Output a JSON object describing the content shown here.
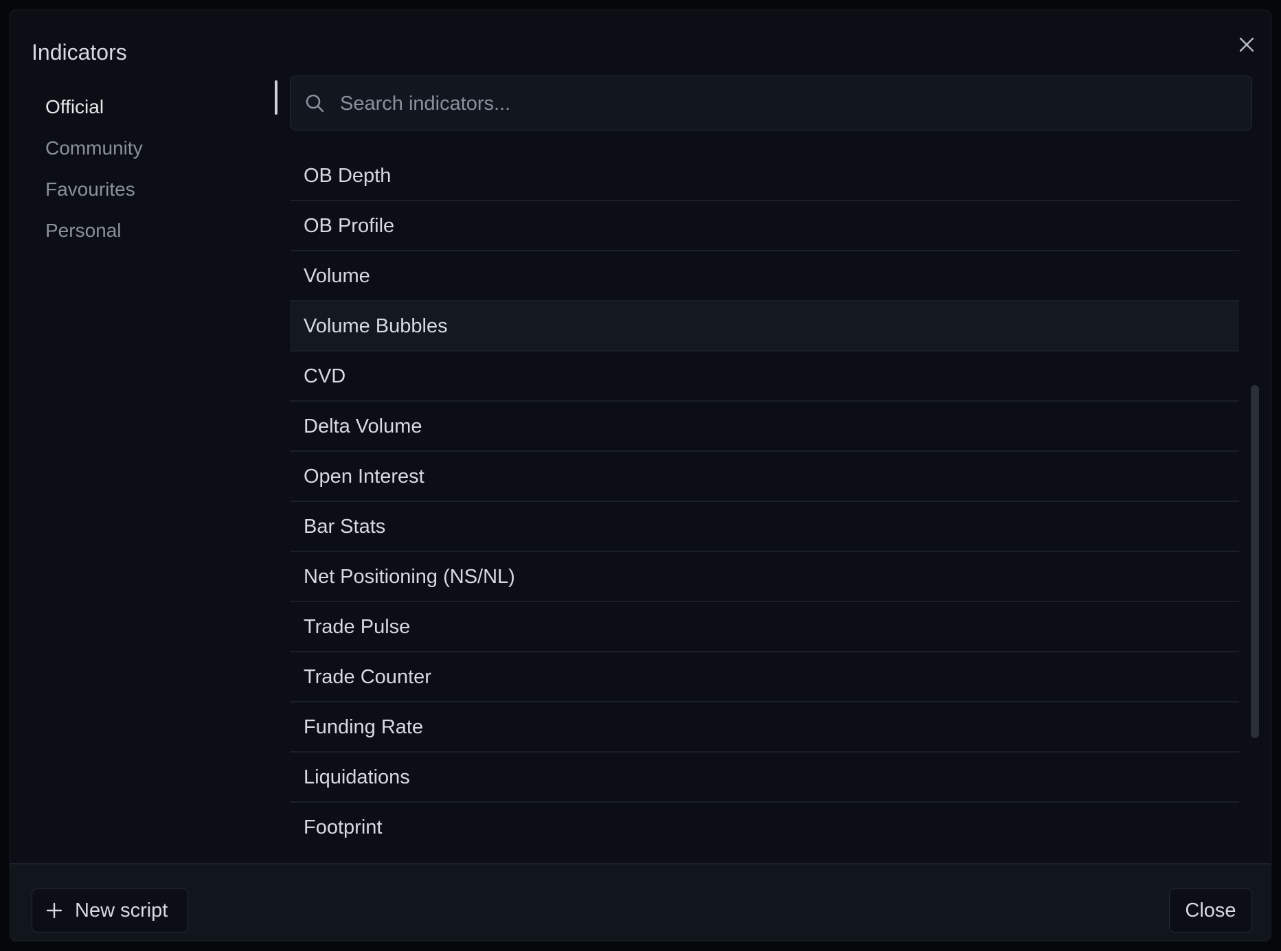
{
  "dialog": {
    "title": "Indicators",
    "close_icon": "close-icon"
  },
  "sidebar": {
    "items": [
      {
        "label": "Official",
        "active": true
      },
      {
        "label": "Community",
        "active": false
      },
      {
        "label": "Favourites",
        "active": false
      },
      {
        "label": "Personal",
        "active": false
      }
    ]
  },
  "search": {
    "placeholder": "Search indicators...",
    "value": "",
    "icon": "search-icon"
  },
  "list": {
    "items": [
      "OB Depth",
      "OB Profile",
      "Volume",
      "Volume Bubbles",
      "CVD",
      "Delta Volume",
      "Open Interest",
      "Bar Stats",
      "Net Positioning (NS/NL)",
      "Trade Pulse",
      "Trade Counter",
      "Funding Rate",
      "Liquidations",
      "Footprint"
    ],
    "hovered_index": 3
  },
  "footer": {
    "new_script_label": "New script",
    "new_script_icon": "plus-icon",
    "close_label": "Close"
  },
  "colors": {
    "background": "#0b0e14",
    "text": "#d7dae0",
    "muted_text": "#8b919c",
    "border": "#1c212b"
  }
}
